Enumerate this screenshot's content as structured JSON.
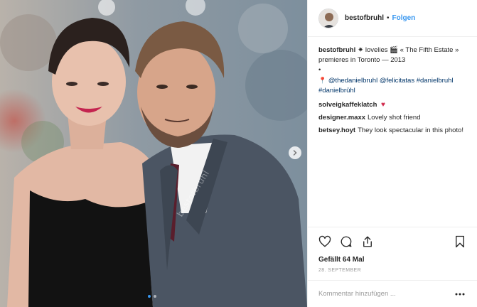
{
  "post": {
    "username": "bestofbruhl",
    "header_separator": "•",
    "follow_label": "Folgen",
    "watermark": "bestofbruhl",
    "likes": "Gefällt 64 Mal",
    "date": "28. SEPTEMBER",
    "add_comment_placeholder": "Kommentar hinzufügen ..."
  },
  "caption": {
    "user": "bestofbruhl",
    "text_line1": "✷ lovelies 🎬 « The Fifth Estate »",
    "text_line2": "premieres in Toronto — 2013",
    "bullet": "•",
    "pin_glyph": "📍",
    "tags": [
      "@thedanielbruhl",
      "@felicitatas",
      "#danielbruhl",
      "#danielbrühl"
    ]
  },
  "comments": [
    {
      "user": "solveigkaffeklatch",
      "text": "",
      "emoji": "♥"
    },
    {
      "user": "designer.maxx",
      "text": "Lovely shot friend"
    },
    {
      "user": "betsey.hoyt",
      "text": "They look spectacular in this photo!"
    }
  ],
  "icons": [
    "heart-icon",
    "comment-icon",
    "share-icon",
    "bookmark-icon",
    "more-options-icon",
    "chevron-right-icon"
  ],
  "colors": {
    "link": "#003569",
    "accent": "#3897f0",
    "muted": "#999999",
    "heart": "#d0294c"
  }
}
